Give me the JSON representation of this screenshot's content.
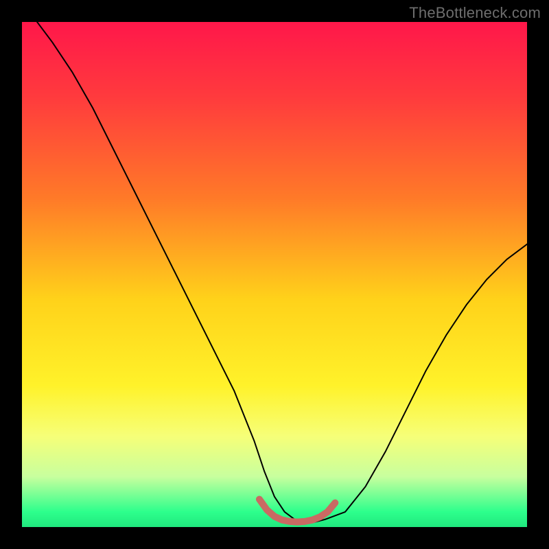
{
  "watermark": "TheBottleneck.com",
  "chart_data": {
    "type": "line",
    "title": "",
    "xlabel": "",
    "ylabel": "",
    "xlim": [
      0,
      100
    ],
    "ylim": [
      0,
      100
    ],
    "grid": false,
    "legend": false,
    "gradient_stops": [
      {
        "offset": 0,
        "color": "#ff174a"
      },
      {
        "offset": 15,
        "color": "#ff3b3d"
      },
      {
        "offset": 35,
        "color": "#ff7a28"
      },
      {
        "offset": 55,
        "color": "#ffd21a"
      },
      {
        "offset": 72,
        "color": "#fff22a"
      },
      {
        "offset": 82,
        "color": "#f6ff78"
      },
      {
        "offset": 90,
        "color": "#c8ff9e"
      },
      {
        "offset": 97,
        "color": "#2dff8c"
      },
      {
        "offset": 100,
        "color": "#20e87e"
      }
    ],
    "series": [
      {
        "name": "bottleneck-curve",
        "stroke": "#000000",
        "stroke_width": 2,
        "x": [
          3,
          6,
          10,
          14,
          18,
          22,
          26,
          30,
          34,
          38,
          42,
          46,
          48,
          50,
          52,
          54,
          56,
          58,
          60,
          64,
          68,
          72,
          76,
          80,
          84,
          88,
          92,
          96,
          100
        ],
        "y": [
          100,
          96,
          90,
          83,
          75,
          67,
          59,
          51,
          43,
          35,
          27,
          17,
          11,
          6,
          3,
          1.5,
          1,
          1,
          1.5,
          3,
          8,
          15,
          23,
          31,
          38,
          44,
          49,
          53,
          56
        ]
      },
      {
        "name": "optimal-band",
        "stroke": "#c96a63",
        "stroke_width": 10,
        "x": [
          47,
          48.5,
          50,
          51.5,
          53,
          54.5,
          56,
          57.5,
          59,
          60.5,
          62
        ],
        "y": [
          5.5,
          3.4,
          2.1,
          1.4,
          1.1,
          1.0,
          1.1,
          1.4,
          2.0,
          3.0,
          4.8
        ]
      }
    ]
  }
}
